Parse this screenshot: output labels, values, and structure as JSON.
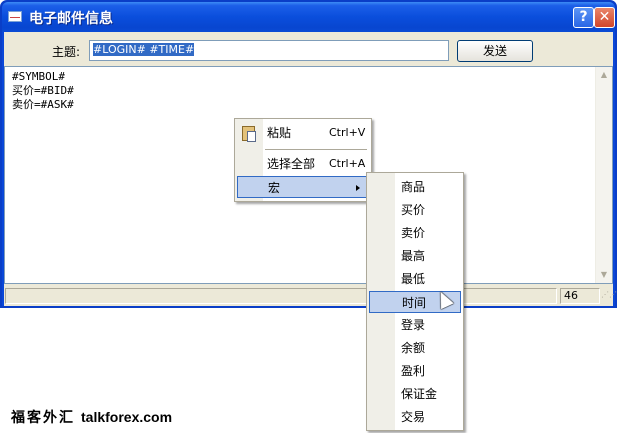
{
  "window": {
    "title": "电子邮件信息",
    "help_label": "?",
    "close_label": "✕"
  },
  "form": {
    "subject_label": "主题:",
    "subject_value": "#LOGIN# #TIME#",
    "send_label": "发送"
  },
  "body": {
    "text": "#SYMBOL#\n买价=#BID#\n卖价=#ASK#"
  },
  "status": {
    "count": "46"
  },
  "context_menu": {
    "items": [
      {
        "label": "粘贴",
        "shortcut": "Ctrl+V",
        "icon": "paste-icon"
      },
      {
        "label": "选择全部",
        "shortcut": "Ctrl+A"
      },
      {
        "label": "宏"
      }
    ]
  },
  "submenu": {
    "items": [
      "商品",
      "买价",
      "卖价",
      "最高",
      "最低",
      "时间",
      "登录",
      "余额",
      "盈利",
      "保证金",
      "交易"
    ],
    "highlighted": "时间"
  },
  "watermark": {
    "cn": "福客外汇",
    "en": "talkforex.com"
  }
}
